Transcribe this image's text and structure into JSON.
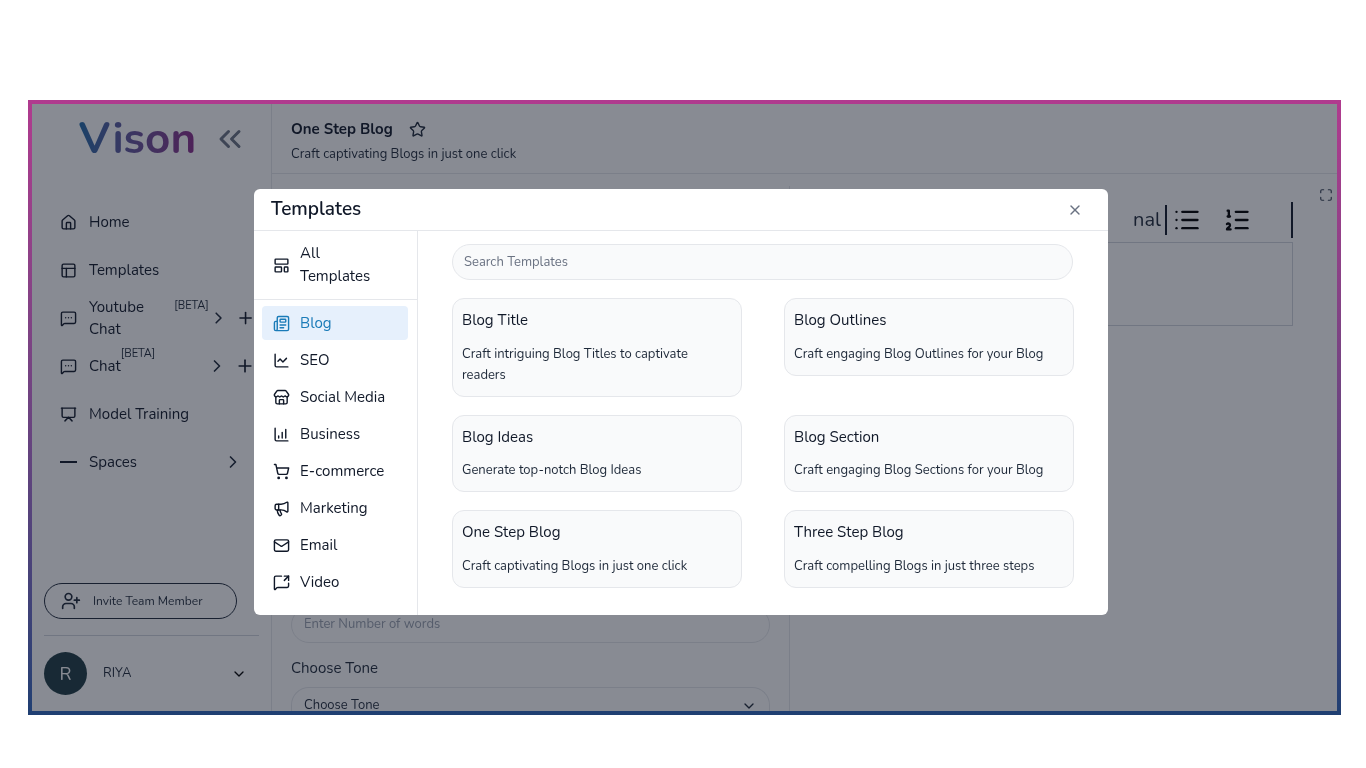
{
  "logo": {
    "text": "Vison"
  },
  "sidebar": {
    "items": [
      {
        "label": "Home",
        "chevron": false,
        "add": false
      },
      {
        "label": "Templates",
        "chevron": false,
        "add": false
      },
      {
        "label": "Youtube Chat",
        "badge": "[BETA]",
        "chevron": true,
        "add": true
      },
      {
        "label": "Chat",
        "badge": "[BETA]",
        "chevron": true,
        "add": true
      },
      {
        "label": "Model Training",
        "chevron": false,
        "add": false
      },
      {
        "label": "Spaces",
        "chevron": true,
        "add": false
      }
    ],
    "invite_button": "Invite Team Member",
    "user": {
      "initial": "R",
      "name": "RIYA"
    }
  },
  "header": {
    "title": "One Step Blog",
    "starred": false,
    "subtitle": "Craft captivating Blogs in just one click"
  },
  "form": {
    "words_placeholder": "Enter Number of words",
    "tone_label": "Choose Tone",
    "tone_value": "Choose Tone"
  },
  "editor": {
    "toolbar_text": "nal"
  },
  "modal": {
    "title": "Templates",
    "categories": [
      {
        "label": "All Templates",
        "selected": false
      },
      {
        "label": "Blog",
        "selected": true
      },
      {
        "label": "SEO",
        "selected": false
      },
      {
        "label": "Social Media",
        "selected": false
      },
      {
        "label": "Business",
        "selected": false
      },
      {
        "label": "E-commerce",
        "selected": false
      },
      {
        "label": "Marketing",
        "selected": false
      },
      {
        "label": "Email",
        "selected": false
      },
      {
        "label": "Video",
        "selected": false
      }
    ],
    "search_placeholder": "Search Templates",
    "templates": [
      {
        "title": "Blog Title",
        "description": "Craft intriguing Blog Titles to captivate readers"
      },
      {
        "title": "Blog Outlines",
        "description": "Craft engaging Blog Outlines for your Blog"
      },
      {
        "title": "Blog Ideas",
        "description": "Generate top-notch Blog Ideas"
      },
      {
        "title": "Blog Section",
        "description": "Craft engaging Blog Sections for your Blog"
      },
      {
        "title": "One Step Blog",
        "description": "Craft captivating Blogs in just one click"
      },
      {
        "title": "Three Step Blog",
        "description": "Craft compelling Blogs in just three steps"
      }
    ]
  }
}
